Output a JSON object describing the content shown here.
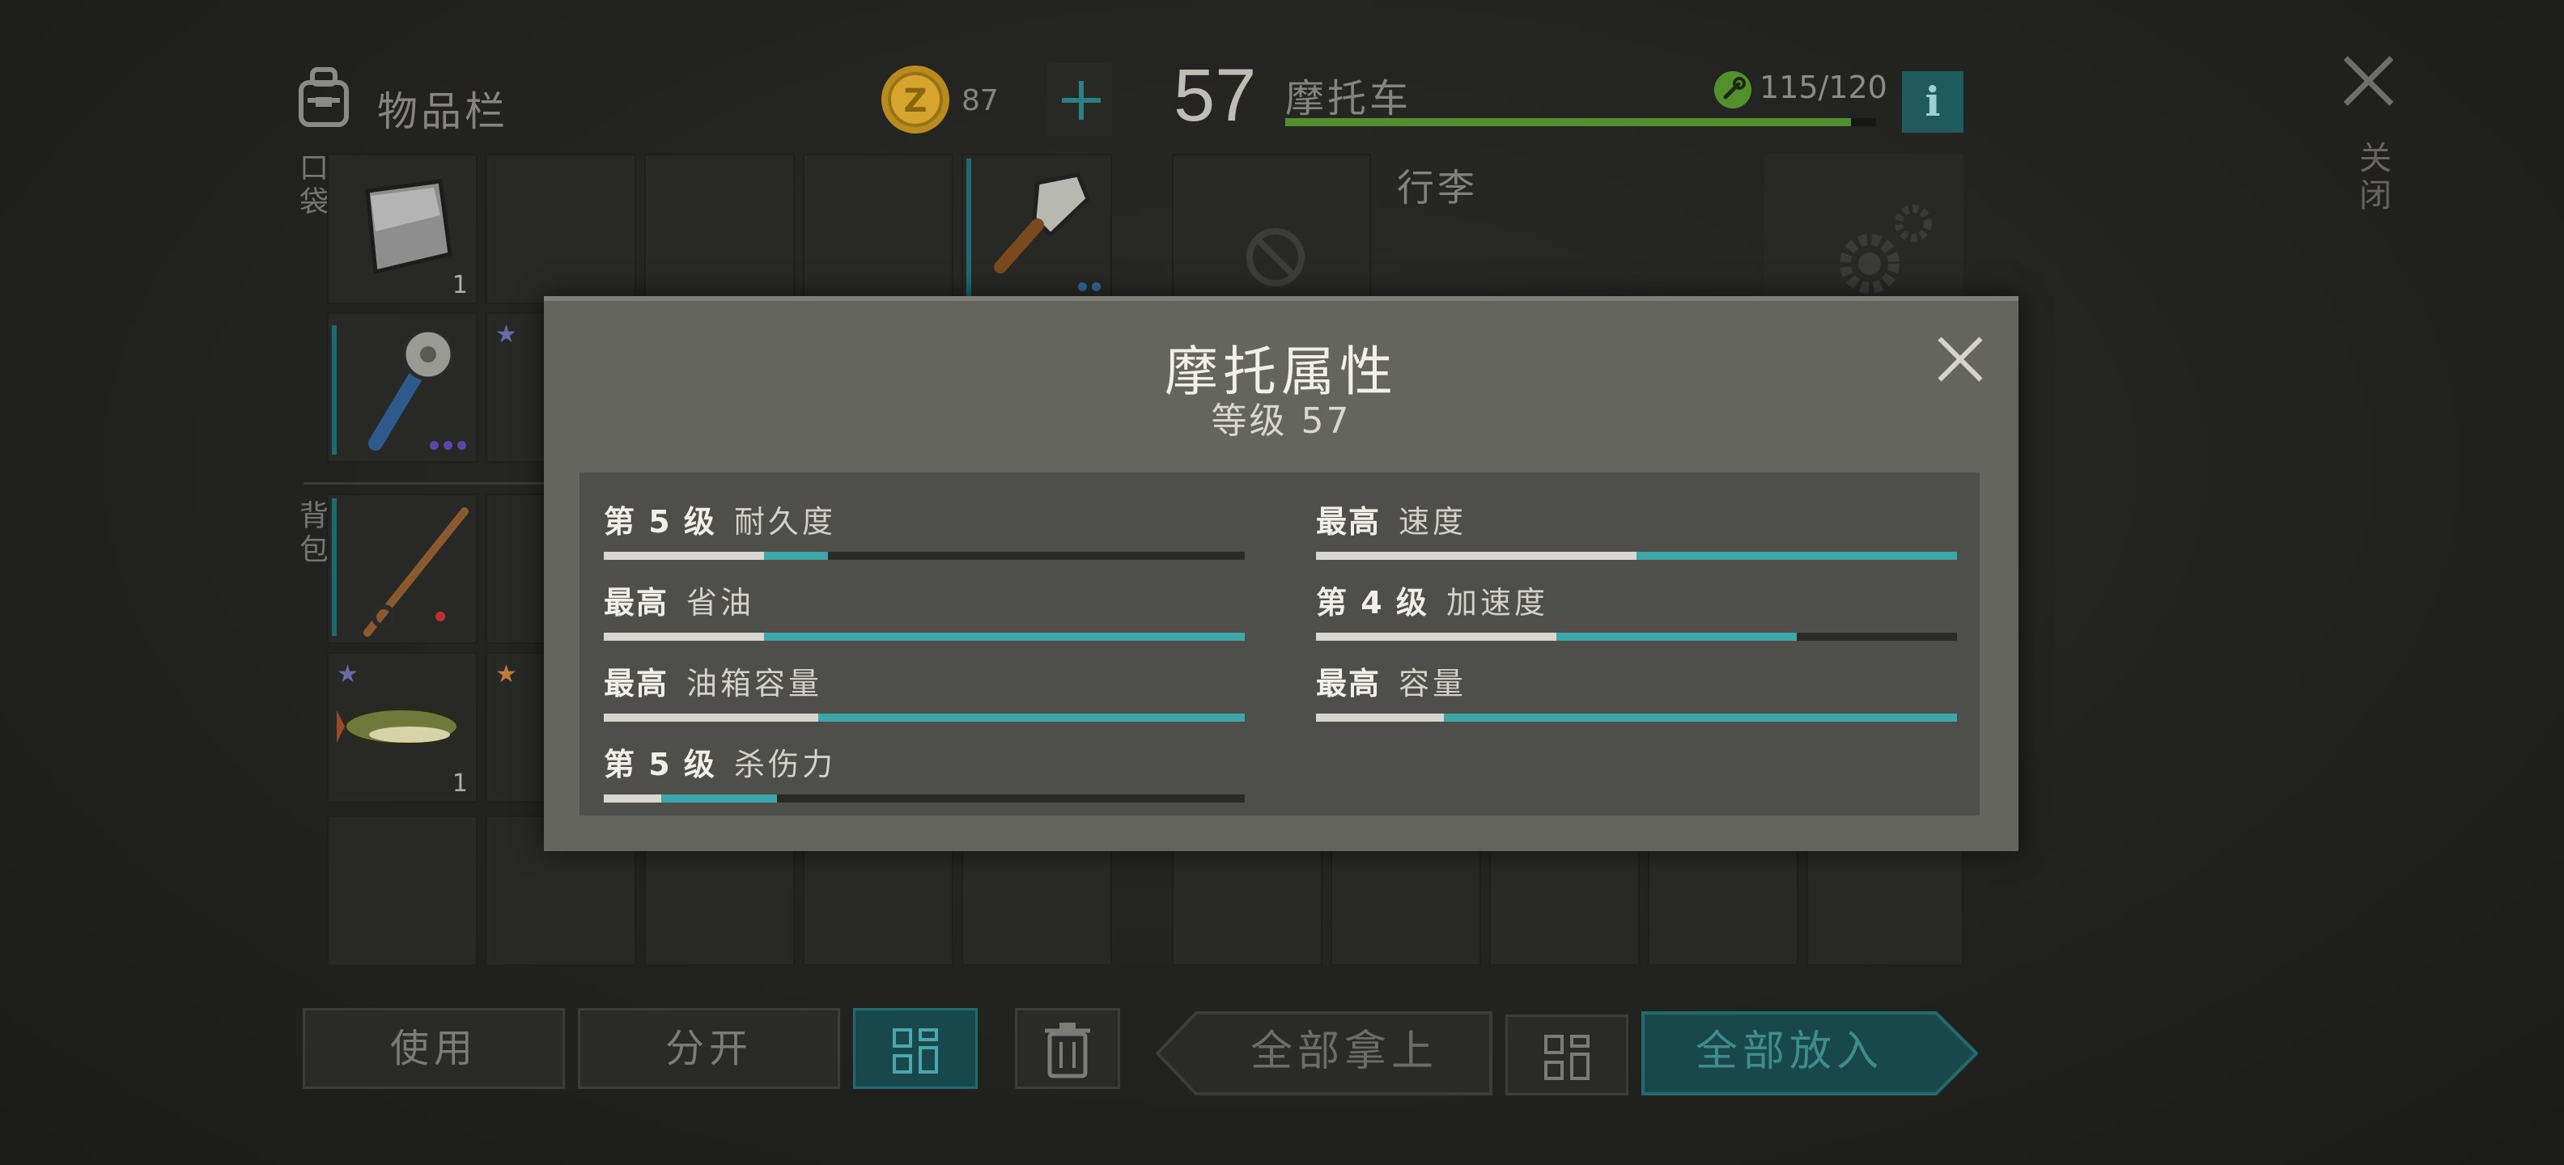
{
  "inventory": {
    "title": "物品栏",
    "coins": "87",
    "pocket_label": "口袋",
    "backpack_label": "背包",
    "slots": {
      "duct_tape_count": "1",
      "pike_count": "1"
    }
  },
  "vehicle": {
    "level": "57",
    "name": "摩托车",
    "durability": "115/120",
    "durability_fraction": 0.958,
    "info_label": "i",
    "luggage_label": "行李",
    "close_label": "关闭"
  },
  "buttons": {
    "use": "使用",
    "split": "分开",
    "take_all": "全部拿上",
    "put_all": "全部放入"
  },
  "modal": {
    "title": "摩托属性",
    "subtitle": "等级 57",
    "stats": [
      {
        "level": "第 5 级",
        "name": "耐久度",
        "base": 0.25,
        "bonus": 0.1
      },
      {
        "level": "最高",
        "name": "速度",
        "base": 0.5,
        "bonus": 0.5
      },
      {
        "level": "最高",
        "name": "省油",
        "base": 0.25,
        "bonus": 0.75
      },
      {
        "level": "第 4 级",
        "name": "加速度",
        "base": 0.375,
        "bonus": 0.375
      },
      {
        "level": "最高",
        "name": "油箱容量",
        "base": 0.335,
        "bonus": 0.665
      },
      {
        "level": "最高",
        "name": "容量",
        "base": 0.2,
        "bonus": 0.8
      },
      {
        "level": "第 5 级",
        "name": "杀伤力",
        "base": 0.09,
        "bonus": 0.18
      }
    ]
  },
  "colors": {
    "accent": "#3ea6a8",
    "durability_green": "#52902e",
    "background": "#222220"
  },
  "icons": [
    "backpack-icon",
    "coin-icon",
    "plus-icon",
    "wrench-icon",
    "info-icon",
    "close-icon",
    "gear-icon",
    "grid-icon",
    "trash-icon",
    "blocked-icon"
  ]
}
